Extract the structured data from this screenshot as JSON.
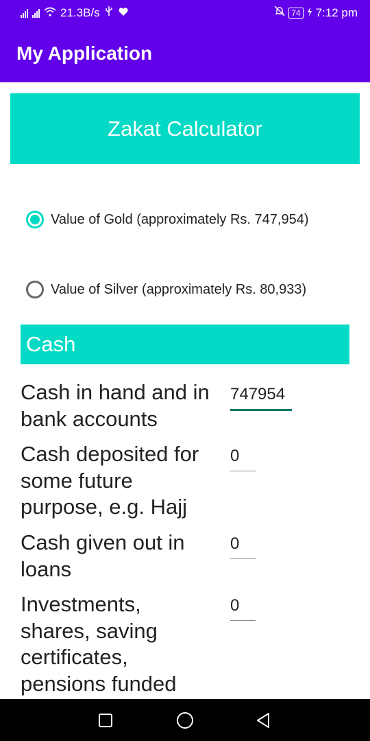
{
  "status_bar": {
    "network_speed": "21.3B/s",
    "battery_level": "74",
    "time": "7:12 pm"
  },
  "app_bar": {
    "title": "My Application"
  },
  "calculator": {
    "header": "Zakat Calculator",
    "nisab_options": [
      {
        "label": "Value of Gold (approximately Rs. 747,954)",
        "selected": true
      },
      {
        "label": "Value of Silver (approximately Rs. 80,933)",
        "selected": false
      }
    ]
  },
  "cash_section": {
    "title": "Cash",
    "fields": [
      {
        "label": "Cash in hand and in bank accounts",
        "value": "747954"
      },
      {
        "label": "Cash deposited for some future purpose, e.g. Hajj",
        "value": "0"
      },
      {
        "label": "Cash given out in loans",
        "value": "0"
      },
      {
        "label": "Investments, shares, saving certificates, pensions funded",
        "value": "0"
      }
    ]
  },
  "colors": {
    "primary": "#6200ea",
    "accent": "#03dac5",
    "input_active": "#00796b"
  }
}
